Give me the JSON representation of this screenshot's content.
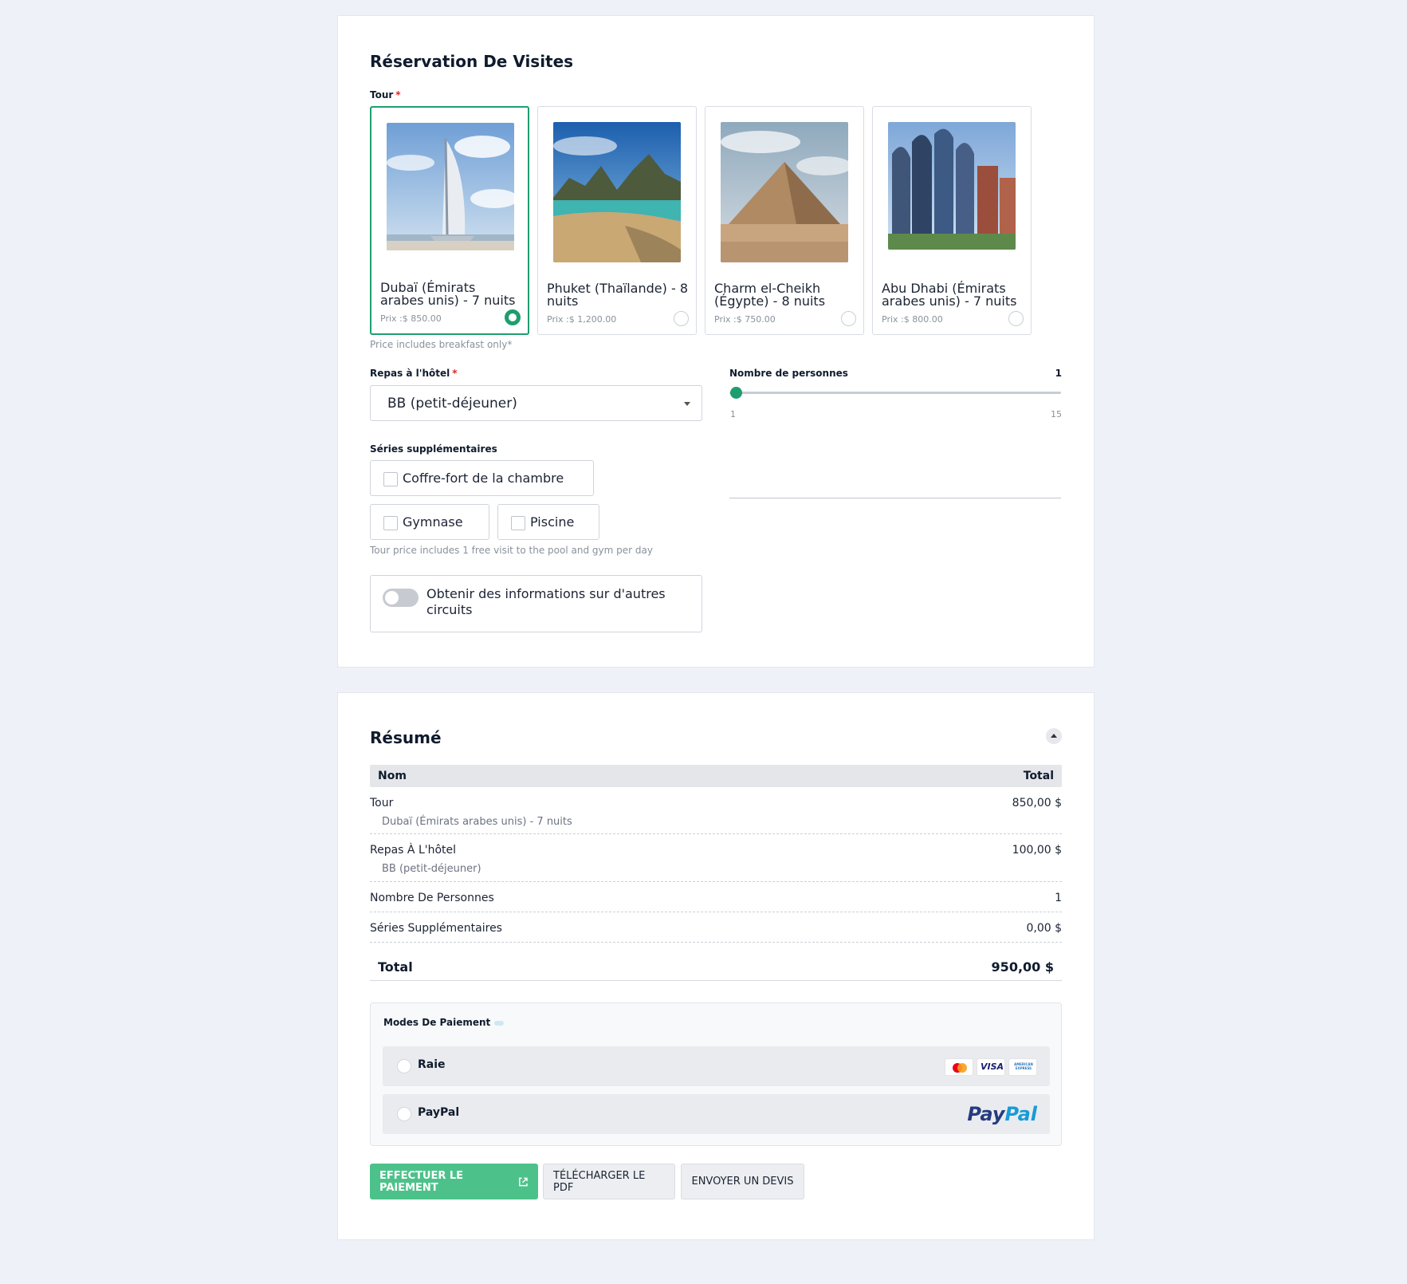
{
  "booking": {
    "title": "Réservation De Visites",
    "tour_label": "Tour",
    "required_mark": "*",
    "tours": [
      {
        "name": "Dubaï (Émirats arabes unis) - 7 nuits",
        "price": "Prix :$ 850.00",
        "selected": true
      },
      {
        "name": "Phuket (Thaïlande) - 8 nuits",
        "price": "Prix :$ 1,200.00",
        "selected": false
      },
      {
        "name": "Charm el-Cheikh (Égypte) - 8 nuits",
        "price": "Prix :$ 750.00",
        "selected": false
      },
      {
        "name": "Abu Dhabi (Émirats arabes unis) - 7 nuits",
        "price": "Prix :$ 800.00",
        "selected": false
      }
    ],
    "tour_hint": "Price includes breakfast only*",
    "meal_label": "Repas à l'hôtel",
    "meal_value": "BB (petit-déjeuner)",
    "persons_label": "Nombre de personnes",
    "persons_value": "1",
    "persons_min": "1",
    "persons_max": "15",
    "extras_label": "Séries supplémentaires",
    "extras": [
      {
        "label": "Coffre-fort de la chambre",
        "checked": false
      },
      {
        "label": "Gymnase",
        "checked": false
      },
      {
        "label": "Piscine",
        "checked": false
      }
    ],
    "extras_hint": "Tour price includes 1 free visit to the pool and gym per day",
    "toggle_label": "Obtenir des informations sur d'autres circuits",
    "toggle_on": false
  },
  "summary": {
    "title": "Résumé",
    "col_name": "Nom",
    "col_total": "Total",
    "rows": [
      {
        "name": "Tour",
        "sub": "Dubaï (Émirats arabes unis) - 7 nuits",
        "value": "850,00 $"
      },
      {
        "name": "Repas À L'hôtel",
        "sub": "BB (petit-déjeuner)",
        "value": "100,00 $"
      },
      {
        "name": "Nombre De Personnes",
        "sub": "",
        "value": "1"
      },
      {
        "name": "Séries Supplémentaires",
        "sub": "",
        "value": "0,00 $"
      }
    ],
    "total_label": "Total",
    "total_value": "950,00 $",
    "payment_title": "Modes De Paiement",
    "payment_options": [
      {
        "label": "Raie"
      },
      {
        "label": "PayPal"
      }
    ],
    "card_brands": [
      "mastercard-icon",
      "visa-icon",
      "amex-icon"
    ],
    "visa_text": "VISA",
    "amex_text": "AMERICAN EXPRESS",
    "paypal_logo_a": "Pay",
    "paypal_logo_b": "Pal",
    "btn_pay": "EFFECTUER LE PAIEMENT",
    "btn_pdf": "TÉLÉCHARGER LE PDF",
    "btn_quote": "ENVOYER UN DEVIS"
  },
  "colors": {
    "accent": "#1e9e6e",
    "button_primary": "#4cc28a",
    "background": "#eef1f7"
  }
}
